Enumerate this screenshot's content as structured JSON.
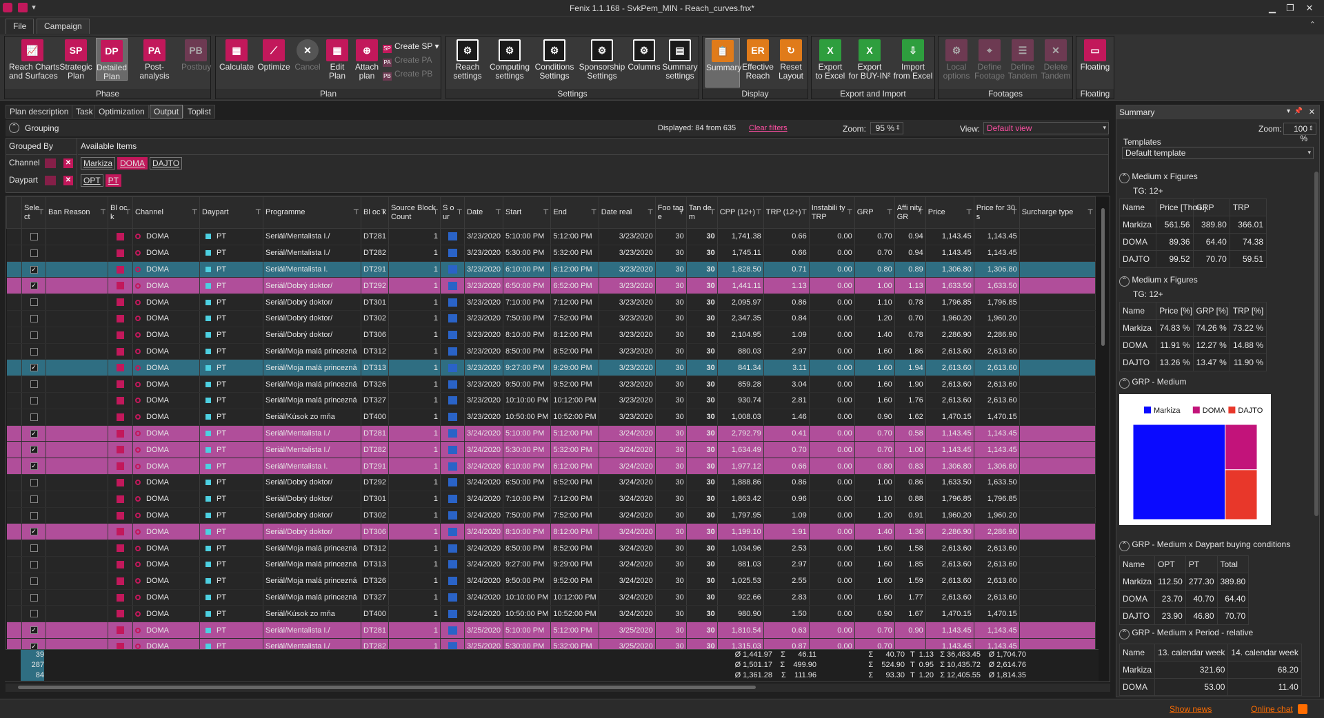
{
  "window": {
    "title": "Fenix 1.1.168 - SvkPem_MIN - Reach_curves.fnx*"
  },
  "menu": {
    "file": "File",
    "campaign": "Campaign"
  },
  "ribbon": {
    "phase": {
      "label": "Phase",
      "buttons": [
        {
          "icon": "RC",
          "label": "Reach Charts\nand Surfaces"
        },
        {
          "icon": "SP",
          "label": "Strategic\nPlan"
        },
        {
          "icon": "DP",
          "label": "Detailed\nPlan"
        },
        {
          "icon": "PA",
          "label": "Post-analysis"
        },
        {
          "icon": "PB",
          "label": "Postbuy"
        }
      ]
    },
    "plan": {
      "label": "Plan",
      "buttons": [
        {
          "label": "Calculate"
        },
        {
          "label": "Optimize"
        },
        {
          "label": "Cancel"
        },
        {
          "label": "Edit\nPlan"
        },
        {
          "label": "Attach\nplan"
        }
      ],
      "create_sp": "Create SP",
      "create_pa": "Create PA",
      "create_pb": "Create PB"
    },
    "settings": {
      "label": "Settings",
      "buttons": [
        {
          "label": "Reach\nsettings"
        },
        {
          "label": "Computing\nsettings"
        },
        {
          "label": "Conditions\nSettings"
        },
        {
          "label": "Sponsorship\nSettings"
        },
        {
          "label": "Columns"
        },
        {
          "label": "Summary\nsettings"
        }
      ]
    },
    "display": {
      "label": "Display",
      "buttons": [
        {
          "label": "Summary"
        },
        {
          "icon": "ER",
          "label": "Effective\nReach"
        },
        {
          "label": "Reset\nLayout"
        }
      ]
    },
    "export": {
      "label": "Export and Import",
      "buttons": [
        {
          "label": "Export\nto Excel"
        },
        {
          "label": "Export\nfor BUY-IN²"
        },
        {
          "label": "Import\nfrom Excel"
        }
      ]
    },
    "footages": {
      "label": "Footages",
      "buttons": [
        {
          "label": "Local\noptions"
        },
        {
          "label": "Define\nFootage"
        },
        {
          "label": "Define\nTandem"
        },
        {
          "label": "Delete\nTandem"
        }
      ]
    },
    "floating": {
      "label": "Floating",
      "buttons": [
        {
          "label": "Floating"
        }
      ]
    }
  },
  "view_tabs": [
    "Plan description",
    "Task",
    "Optimization",
    "Output",
    "Toplist"
  ],
  "grouping": {
    "title": "Grouping",
    "displayed": "Displayed: 84 from 635",
    "clear_filters": "Clear filters",
    "zoom_label": "Zoom:",
    "zoom_value": "95 %",
    "view_label": "View:",
    "view_value": "Default view",
    "grouped_by": "Grouped By",
    "available_items": "Available Items",
    "channel_label": "Channel",
    "channel_items": [
      "Markiza",
      "DOMA",
      "DAJTO"
    ],
    "daypart_label": "Daypart",
    "daypart_items": [
      "OPT",
      "PT"
    ]
  },
  "columns": [
    "Sele ct",
    "Ban Reason",
    "Bl oc k",
    "Channel",
    "Daypart",
    "Programme",
    "Bl oc k",
    "Source Block Count",
    "S o ur",
    "Date",
    "Start",
    "End",
    "Date real",
    "Foo tag e",
    "Tan de m",
    "CPP (12+)",
    "TRP (12+)",
    "Instabili ty TRP",
    "GRP",
    "Affi nity GR",
    "Price",
    "Price for 30 s",
    "Surcharge type"
  ],
  "rows": [
    {
      "hl": "",
      "chk": false,
      "prog": "Seriál/Mentalista I./",
      "block": "DT281",
      "date": "3/23/2020",
      "start": "5:10:00 PM",
      "end": "5:12:00 PM",
      "cpp": "1,741.38",
      "trp": "0.66",
      "grp": "0.70",
      "aff": "0.94",
      "price": "1,143.45",
      "p30": "1,143.45"
    },
    {
      "hl": "",
      "chk": false,
      "prog": "Seriál/Mentalista I./",
      "block": "DT282",
      "date": "3/23/2020",
      "start": "5:30:00 PM",
      "end": "5:32:00 PM",
      "cpp": "1,745.11",
      "trp": "0.66",
      "grp": "0.70",
      "aff": "0.94",
      "price": "1,143.45",
      "p30": "1,143.45"
    },
    {
      "hl": "teal",
      "chk": true,
      "prog": "Seriál/Mentalista I.",
      "block": "DT291",
      "date": "3/23/2020",
      "start": "6:10:00 PM",
      "end": "6:12:00 PM",
      "cpp": "1,828.50",
      "trp": "0.71",
      "grp": "0.80",
      "aff": "0.89",
      "price": "1,306.80",
      "p30": "1,306.80"
    },
    {
      "hl": "purple",
      "chk": true,
      "prog": "Seriál/Dobrý doktor/",
      "block": "DT292",
      "date": "3/23/2020",
      "start": "6:50:00 PM",
      "end": "6:52:00 PM",
      "cpp": "1,441.11",
      "trp": "1.13",
      "grp": "1.00",
      "aff": "1.13",
      "price": "1,633.50",
      "p30": "1,633.50"
    },
    {
      "hl": "",
      "chk": false,
      "prog": "Seriál/Dobrý doktor/",
      "block": "DT301",
      "date": "3/23/2020",
      "start": "7:10:00 PM",
      "end": "7:12:00 PM",
      "cpp": "2,095.97",
      "trp": "0.86",
      "grp": "1.10",
      "aff": "0.78",
      "price": "1,796.85",
      "p30": "1,796.85"
    },
    {
      "hl": "",
      "chk": false,
      "prog": "Seriál/Dobrý doktor/",
      "block": "DT302",
      "date": "3/23/2020",
      "start": "7:50:00 PM",
      "end": "7:52:00 PM",
      "cpp": "2,347.35",
      "trp": "0.84",
      "grp": "1.20",
      "aff": "0.70",
      "price": "1,960.20",
      "p30": "1,960.20"
    },
    {
      "hl": "",
      "chk": false,
      "prog": "Seriál/Dobrý doktor/",
      "block": "DT306",
      "date": "3/23/2020",
      "start": "8:10:00 PM",
      "end": "8:12:00 PM",
      "cpp": "2,104.95",
      "trp": "1.09",
      "grp": "1.40",
      "aff": "0.78",
      "price": "2,286.90",
      "p30": "2,286.90"
    },
    {
      "hl": "",
      "chk": false,
      "prog": "Seriál/Moja malá princezná",
      "block": "DT312",
      "date": "3/23/2020",
      "start": "8:50:00 PM",
      "end": "8:52:00 PM",
      "cpp": "880.03",
      "trp": "2.97",
      "grp": "1.60",
      "aff": "1.86",
      "price": "2,613.60",
      "p30": "2,613.60"
    },
    {
      "hl": "teal",
      "chk": true,
      "prog": "Seriál/Moja malá princezná",
      "block": "DT313",
      "date": "3/23/2020",
      "start": "9:27:00 PM",
      "end": "9:29:00 PM",
      "cpp": "841.34",
      "trp": "3.11",
      "grp": "1.60",
      "aff": "1.94",
      "price": "2,613.60",
      "p30": "2,613.60"
    },
    {
      "hl": "",
      "chk": false,
      "prog": "Seriál/Moja malá princezná",
      "block": "DT326",
      "date": "3/23/2020",
      "start": "9:50:00 PM",
      "end": "9:52:00 PM",
      "cpp": "859.28",
      "trp": "3.04",
      "grp": "1.60",
      "aff": "1.90",
      "price": "2,613.60",
      "p30": "2,613.60"
    },
    {
      "hl": "",
      "chk": false,
      "prog": "Seriál/Moja malá princezná",
      "block": "DT327",
      "date": "3/23/2020",
      "start": "10:10:00 PM",
      "end": "10:12:00 PM",
      "cpp": "930.74",
      "trp": "2.81",
      "grp": "1.60",
      "aff": "1.76",
      "price": "2,613.60",
      "p30": "2,613.60"
    },
    {
      "hl": "",
      "chk": false,
      "prog": "Seriál/Kúsok zo mňa",
      "block": "DT400",
      "date": "3/23/2020",
      "start": "10:50:00 PM",
      "end": "10:52:00 PM",
      "cpp": "1,008.03",
      "trp": "1.46",
      "grp": "0.90",
      "aff": "1.62",
      "price": "1,470.15",
      "p30": "1,470.15"
    },
    {
      "hl": "purple",
      "chk": true,
      "prog": "Seriál/Mentalista I./",
      "block": "DT281",
      "date": "3/24/2020",
      "start": "5:10:00 PM",
      "end": "5:12:00 PM",
      "cpp": "2,792.79",
      "trp": "0.41",
      "grp": "0.70",
      "aff": "0.58",
      "price": "1,143.45",
      "p30": "1,143.45"
    },
    {
      "hl": "purple",
      "chk": true,
      "prog": "Seriál/Mentalista I./",
      "block": "DT282",
      "date": "3/24/2020",
      "start": "5:30:00 PM",
      "end": "5:32:00 PM",
      "cpp": "1,634.49",
      "trp": "0.70",
      "grp": "0.70",
      "aff": "1.00",
      "price": "1,143.45",
      "p30": "1,143.45"
    },
    {
      "hl": "purple",
      "chk": true,
      "prog": "Seriál/Mentalista I.",
      "block": "DT291",
      "date": "3/24/2020",
      "start": "6:10:00 PM",
      "end": "6:12:00 PM",
      "cpp": "1,977.12",
      "trp": "0.66",
      "grp": "0.80",
      "aff": "0.83",
      "price": "1,306.80",
      "p30": "1,306.80"
    },
    {
      "hl": "",
      "chk": false,
      "prog": "Seriál/Dobrý doktor/",
      "block": "DT292",
      "date": "3/24/2020",
      "start": "6:50:00 PM",
      "end": "6:52:00 PM",
      "cpp": "1,888.86",
      "trp": "0.86",
      "grp": "1.00",
      "aff": "0.86",
      "price": "1,633.50",
      "p30": "1,633.50"
    },
    {
      "hl": "",
      "chk": false,
      "prog": "Seriál/Dobrý doktor/",
      "block": "DT301",
      "date": "3/24/2020",
      "start": "7:10:00 PM",
      "end": "7:12:00 PM",
      "cpp": "1,863.42",
      "trp": "0.96",
      "grp": "1.10",
      "aff": "0.88",
      "price": "1,796.85",
      "p30": "1,796.85"
    },
    {
      "hl": "",
      "chk": false,
      "prog": "Seriál/Dobrý doktor/",
      "block": "DT302",
      "date": "3/24/2020",
      "start": "7:50:00 PM",
      "end": "7:52:00 PM",
      "cpp": "1,797.95",
      "trp": "1.09",
      "grp": "1.20",
      "aff": "0.91",
      "price": "1,960.20",
      "p30": "1,960.20"
    },
    {
      "hl": "purple",
      "chk": true,
      "prog": "Seriál/Dobrý doktor/",
      "block": "DT306",
      "date": "3/24/2020",
      "start": "8:10:00 PM",
      "end": "8:12:00 PM",
      "cpp": "1,199.10",
      "trp": "1.91",
      "grp": "1.40",
      "aff": "1.36",
      "price": "2,286.90",
      "p30": "2,286.90"
    },
    {
      "hl": "",
      "chk": false,
      "prog": "Seriál/Moja malá princezná",
      "block": "DT312",
      "date": "3/24/2020",
      "start": "8:50:00 PM",
      "end": "8:52:00 PM",
      "cpp": "1,034.96",
      "trp": "2.53",
      "grp": "1.60",
      "aff": "1.58",
      "price": "2,613.60",
      "p30": "2,613.60"
    },
    {
      "hl": "",
      "chk": false,
      "prog": "Seriál/Moja malá princezná",
      "block": "DT313",
      "date": "3/24/2020",
      "start": "9:27:00 PM",
      "end": "9:29:00 PM",
      "cpp": "881.03",
      "trp": "2.97",
      "grp": "1.60",
      "aff": "1.85",
      "price": "2,613.60",
      "p30": "2,613.60"
    },
    {
      "hl": "",
      "chk": false,
      "prog": "Seriál/Moja malá princezná",
      "block": "DT326",
      "date": "3/24/2020",
      "start": "9:50:00 PM",
      "end": "9:52:00 PM",
      "cpp": "1,025.53",
      "trp": "2.55",
      "grp": "1.60",
      "aff": "1.59",
      "price": "2,613.60",
      "p30": "2,613.60"
    },
    {
      "hl": "",
      "chk": false,
      "prog": "Seriál/Moja malá princezná",
      "block": "DT327",
      "date": "3/24/2020",
      "start": "10:10:00 PM",
      "end": "10:12:00 PM",
      "cpp": "922.66",
      "trp": "2.83",
      "grp": "1.60",
      "aff": "1.77",
      "price": "2,613.60",
      "p30": "2,613.60"
    },
    {
      "hl": "",
      "chk": false,
      "prog": "Seriál/Kúsok zo mňa",
      "block": "DT400",
      "date": "3/24/2020",
      "start": "10:50:00 PM",
      "end": "10:52:00 PM",
      "cpp": "980.90",
      "trp": "1.50",
      "grp": "0.90",
      "aff": "1.67",
      "price": "1,470.15",
      "p30": "1,470.15"
    },
    {
      "hl": "purple",
      "chk": true,
      "prog": "Seriál/Mentalista I./",
      "block": "DT281",
      "date": "3/25/2020",
      "start": "5:10:00 PM",
      "end": "5:12:00 PM",
      "cpp": "1,810.54",
      "trp": "0.63",
      "grp": "0.70",
      "aff": "0.90",
      "price": "1,143.45",
      "p30": "1,143.45"
    },
    {
      "hl": "purple",
      "chk": true,
      "prog": "Seriál/Mentalista I./",
      "block": "DT282",
      "date": "3/25/2020",
      "start": "5:30:00 PM",
      "end": "5:32:00 PM",
      "cpp": "1,315.03",
      "trp": "0.87",
      "grp": "0.70",
      "aff": "",
      "price": "1,143.45",
      "p30": "1,143.45"
    }
  ],
  "row_constants": {
    "channel": "DOMA",
    "daypart": "PT",
    "count": "1",
    "footage": "30",
    "tandem": "30",
    "instab": "0.00"
  },
  "totals": {
    "select": "39\n287\n84",
    "cpp": "Ø 1,441.97\nØ 1,501.17\nØ 1,361.28",
    "trp": "Σ      46.11\nΣ    499.90\nΣ    111.96",
    "grp": "Σ      40.70\nΣ    524.90\nΣ      93.30",
    "aff": "T  1.13\nT  0.95\nT  1.20",
    "price": "Σ 36,483.45\nΣ 10,435.72\nΣ 12,405.55",
    "p30": "Ø 1,704.70\nØ 2,614.76\nØ 1,814.35"
  },
  "summary": {
    "title": "Summary",
    "zoom_label": "Zoom:",
    "zoom_value": "100 %",
    "templates_label": "Templates",
    "template_value": "Default template",
    "s1": {
      "title": "Medium x Figures",
      "tg": "TG: 12+",
      "head": [
        "Name",
        "Price [Thou.]",
        "GRP",
        "TRP"
      ],
      "rows": [
        [
          "Markiza",
          "561.56",
          "389.80",
          "366.01"
        ],
        [
          "DOMA",
          "89.36",
          "64.40",
          "74.38"
        ],
        [
          "DAJTO",
          "99.52",
          "70.70",
          "59.51"
        ]
      ]
    },
    "s2": {
      "title": "Medium x Figures",
      "tg": "TG: 12+",
      "head": [
        "Name",
        "Price [%]",
        "GRP [%]",
        "TRP [%]"
      ],
      "rows": [
        [
          "Markiza",
          "74.83 %",
          "74.26 %",
          "73.22 %"
        ],
        [
          "DOMA",
          "11.91 %",
          "12.27 %",
          "14.88 %"
        ],
        [
          "DAJTO",
          "13.26 %",
          "13.47 %",
          "11.90 %"
        ]
      ]
    },
    "s3": {
      "title": "GRP - Medium"
    },
    "s4": {
      "title": "GRP - Medium x Daypart buying conditions",
      "head": [
        "Name",
        "OPT",
        "PT",
        "Total"
      ],
      "rows": [
        [
          "Markiza",
          "112.50",
          "277.30",
          "389.80"
        ],
        [
          "DOMA",
          "23.70",
          "40.70",
          "64.40"
        ],
        [
          "DAJTO",
          "23.90",
          "46.80",
          "70.70"
        ]
      ]
    },
    "s5": {
      "title": "GRP - Medium x Period - relative",
      "head": [
        "Name",
        "13. calendar week",
        "14. calendar week"
      ],
      "rows": [
        [
          "Markiza",
          "321.60",
          "68.20"
        ],
        [
          "DOMA",
          "53.00",
          "11.40"
        ]
      ]
    }
  },
  "chart_data": {
    "type": "treemap",
    "title": "GRP - Medium",
    "series": [
      {
        "name": "Markiza",
        "value": 389.8,
        "color": "#0a0aff"
      },
      {
        "name": "DOMA",
        "value": 64.4,
        "color": "#c2137a"
      },
      {
        "name": "DAJTO",
        "value": 70.7,
        "color": "#e8372a"
      }
    ]
  },
  "status": {
    "show_news": "Show news",
    "online_chat": "Online chat"
  }
}
